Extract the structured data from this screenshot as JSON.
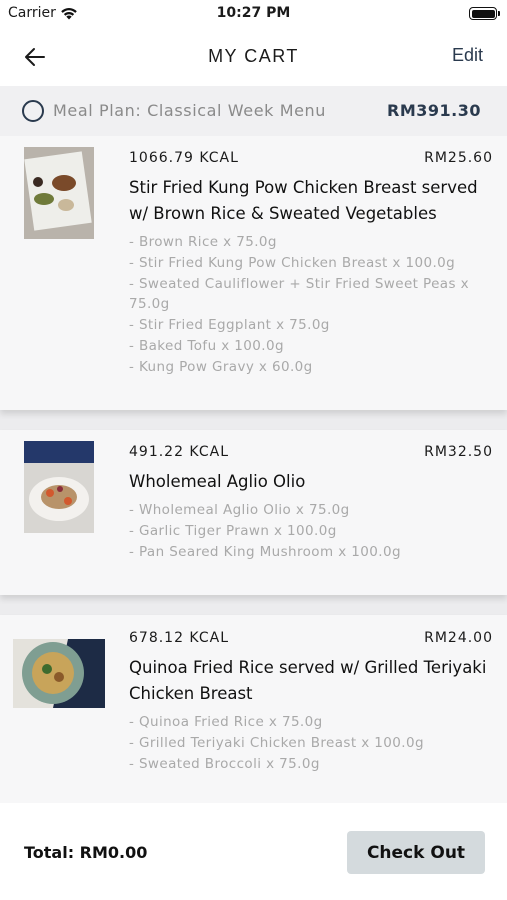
{
  "status_bar": {
    "carrier": "Carrier",
    "time": "10:27 PM"
  },
  "header": {
    "title": "MY CART",
    "edit_label": "Edit"
  },
  "meal_plan": {
    "name": "Meal Plan: Classical Week Menu",
    "price": "RM391.30"
  },
  "items": [
    {
      "kcal": "1066.79 KCAL",
      "price": "RM25.60",
      "dish": "Stir Fried Kung Pow Chicken Breast served w/ Brown Rice & Sweated Vegetables",
      "ingredients": [
        "- Brown Rice x 75.0g",
        "- Stir Fried Kung Pow Chicken Breast x 100.0g",
        "- Sweated Cauliflower + Stir Fried Sweet Peas x 75.0g",
        "- Stir Fried Eggplant x 75.0g",
        "- Baked Tofu x 100.0g",
        "- Kung Pow Gravy x 60.0g"
      ]
    },
    {
      "kcal": "491.22 KCAL",
      "price": "RM32.50",
      "dish": "Wholemeal Aglio Olio",
      "ingredients": [
        "- Wholemeal Aglio Olio x 75.0g",
        "- Garlic Tiger Prawn  x 100.0g",
        "- Pan Seared King Mushroom x 100.0g"
      ]
    },
    {
      "kcal": "678.12 KCAL",
      "price": "RM24.00",
      "dish": "Quinoa Fried Rice served w/ Grilled Teriyaki Chicken Breast",
      "ingredients": [
        "- Quinoa Fried Rice x 75.0g",
        "- Grilled Teriyaki Chicken Breast x 100.0g",
        "- Sweated Broccoli x 75.0g"
      ]
    }
  ],
  "footer": {
    "total": "Total: RM0.00",
    "checkout_label": "Check Out"
  },
  "colors": {
    "accent": "#2a3a4e",
    "checkout_bg": "#d4dadd",
    "ingredient_text": "#a9a9a9"
  }
}
